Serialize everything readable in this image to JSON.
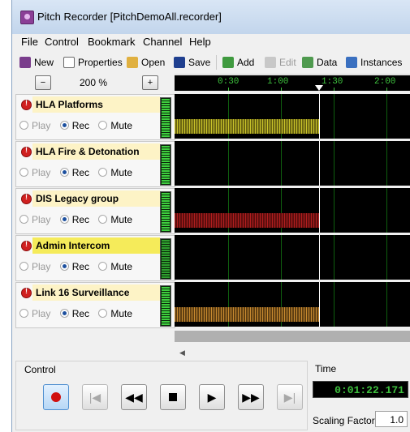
{
  "window": {
    "title": "Pitch Recorder [PitchDemoAll.recorder]"
  },
  "menu": [
    "File",
    "Control",
    "Bookmark",
    "Channel",
    "Help"
  ],
  "toolbar": {
    "new": "New",
    "properties": "Properties",
    "open": "Open",
    "save": "Save",
    "add": "Add",
    "edit": "Edit",
    "data": "Data",
    "instances": "Instances"
  },
  "zoom": {
    "value": "200 %",
    "out_symbol": "−",
    "in_symbol": "+"
  },
  "timeline": {
    "ticks": [
      "0:30",
      "1:00",
      "1:30",
      "2:00"
    ]
  },
  "channels": [
    {
      "name": "HLA Platforms",
      "selected": false,
      "mode": "Rec",
      "signal_color": "#c9c32a",
      "has_signal": true
    },
    {
      "name": "HLA Fire & Detonation",
      "selected": false,
      "mode": "Rec",
      "signal_color": "",
      "has_signal": false
    },
    {
      "name": "DIS Legacy group",
      "selected": false,
      "mode": "Rec",
      "signal_color": "#b01e1e",
      "has_signal": true
    },
    {
      "name": "Admin Intercom",
      "selected": true,
      "mode": "Rec",
      "signal_color": "",
      "has_signal": false
    },
    {
      "name": "Link 16 Surveillance",
      "selected": false,
      "mode": "Rec",
      "signal_color": "#c88a30",
      "has_signal": true
    }
  ],
  "radio_labels": {
    "play": "Play",
    "rec": "Rec",
    "mute": "Mute"
  },
  "control": {
    "label": "Control",
    "buttons": [
      "record-icon",
      "skip-start-icon",
      "rewind-icon",
      "stop-icon",
      "play-icon",
      "fast-forward-icon",
      "skip-end-icon"
    ]
  },
  "time": {
    "label": "Time",
    "value": "0:01:22.171"
  },
  "scaling": {
    "label": "Scaling Factor:",
    "value": "1.0"
  },
  "colors": {
    "accent_green": "#3ec13e",
    "selected_name_bg": "#f5eb5a",
    "name_bg": "#fdf3c6"
  }
}
